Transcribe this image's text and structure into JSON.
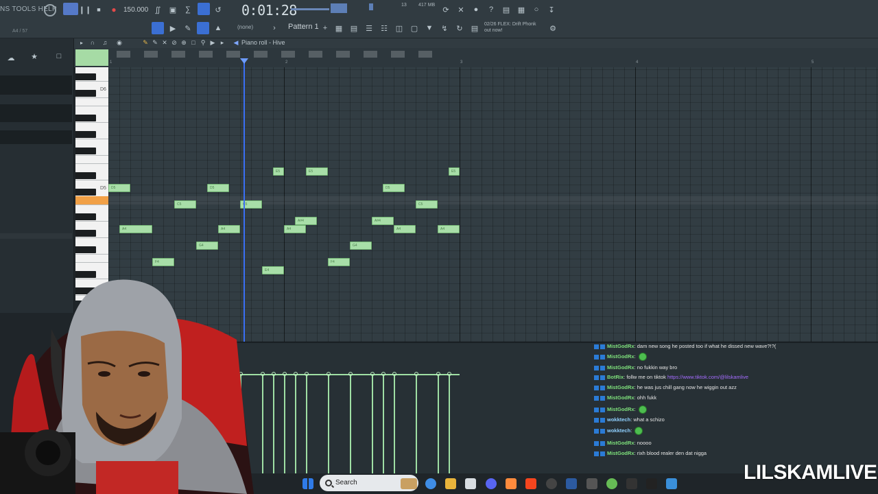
{
  "menu": {
    "label": "NS  TOOLS  HELP"
  },
  "transport": {
    "tempo": "150.000",
    "time": "0:01:28",
    "memory": "417 MB",
    "cpu": "13"
  },
  "toolbar": {
    "pattern_label": "Pattern 1",
    "channel_select": "(none)",
    "news_line1": "02/26  FLEX: Drift Phonk",
    "news_line2": "out now!",
    "hint": "A4 / 57"
  },
  "piano_roll": {
    "title": "Piano roll - Hive",
    "ruler": [
      "1",
      "2",
      "3",
      "4",
      "5"
    ],
    "octave_labels": [
      "D6",
      "D5"
    ],
    "notes": [
      {
        "label": "D5",
        "bar": 1.0,
        "len": 0.25,
        "pitch": "D5"
      },
      {
        "label": "A4",
        "bar": 1.0625,
        "len": 0.375,
        "pitch": "A4"
      },
      {
        "label": "F4",
        "bar": 1.25,
        "len": 0.25,
        "pitch": "F4"
      },
      {
        "label": "C5",
        "bar": 1.375,
        "len": 0.25,
        "pitch": "C5"
      },
      {
        "label": "G4",
        "bar": 1.5,
        "len": 0.25,
        "pitch": "G4"
      },
      {
        "label": "D5",
        "bar": 1.5625,
        "len": 0.25,
        "pitch": "D5"
      },
      {
        "label": "A4",
        "bar": 1.625,
        "len": 0.25,
        "pitch": "A4"
      },
      {
        "label": "C5",
        "bar": 1.75,
        "len": 0.25,
        "pitch": "C5"
      },
      {
        "label": "E4",
        "bar": 1.875,
        "len": 0.25,
        "pitch": "E4"
      },
      {
        "label": "E5",
        "bar": 1.9375,
        "len": 0.125,
        "pitch": "E5"
      },
      {
        "label": "A4",
        "bar": 2.0,
        "len": 0.25,
        "pitch": "A4"
      },
      {
        "label": "A#4",
        "bar": 2.0625,
        "len": 0.25,
        "pitch": "A#4"
      },
      {
        "label": "E5",
        "bar": 2.125,
        "len": 0.25,
        "pitch": "E5"
      },
      {
        "label": "F4",
        "bar": 2.25,
        "len": 0.25,
        "pitch": "F4"
      },
      {
        "label": "G4",
        "bar": 2.375,
        "len": 0.25,
        "pitch": "G4"
      },
      {
        "label": "A#4",
        "bar": 2.5,
        "len": 0.25,
        "pitch": "A#4"
      },
      {
        "label": "D5",
        "bar": 2.5625,
        "len": 0.25,
        "pitch": "D5"
      },
      {
        "label": "A4",
        "bar": 2.625,
        "len": 0.25,
        "pitch": "A4"
      },
      {
        "label": "C5",
        "bar": 2.75,
        "len": 0.25,
        "pitch": "C5"
      },
      {
        "label": "A4",
        "bar": 2.875,
        "len": 0.25,
        "pitch": "A4"
      },
      {
        "label": "E5",
        "bar": 2.9375,
        "len": 0.125,
        "pitch": "E5"
      }
    ]
  },
  "chat": [
    {
      "user": "MistGodRx",
      "text": ": dam new song he posted too if what he dissed new wave?!?(",
      "kind": "text"
    },
    {
      "user": "MistGodRx",
      "text": ":",
      "kind": "emote"
    },
    {
      "user": "MistGodRx",
      "text": ": no fukkin way bro",
      "kind": "text"
    },
    {
      "user": "BotRix",
      "text": ": follw me on tiktok ",
      "link": "https://www.tiktok.com/@lilskamlive",
      "kind": "link"
    },
    {
      "user": "MistGodRx",
      "text": ": he was jus chill gang now he wiggin out azz",
      "kind": "text"
    },
    {
      "user": "MistGodRx",
      "text": ": ohh fukk",
      "kind": "text"
    },
    {
      "user": "MistGodRx",
      "text": ":",
      "kind": "emote"
    },
    {
      "user": "wokktech",
      "text": ": what a schizo",
      "kind": "text"
    },
    {
      "user": "wokktech",
      "text": ":",
      "kind": "emote"
    },
    {
      "user": "MistGodRx",
      "text": ": noooo",
      "kind": "text"
    },
    {
      "user": "MistGodRx",
      "text": ": rixh blood realer den dat nigga",
      "kind": "text"
    }
  ],
  "taskbar": {
    "search_label": "Search"
  },
  "watermark": "LILSKAMLIVE"
}
